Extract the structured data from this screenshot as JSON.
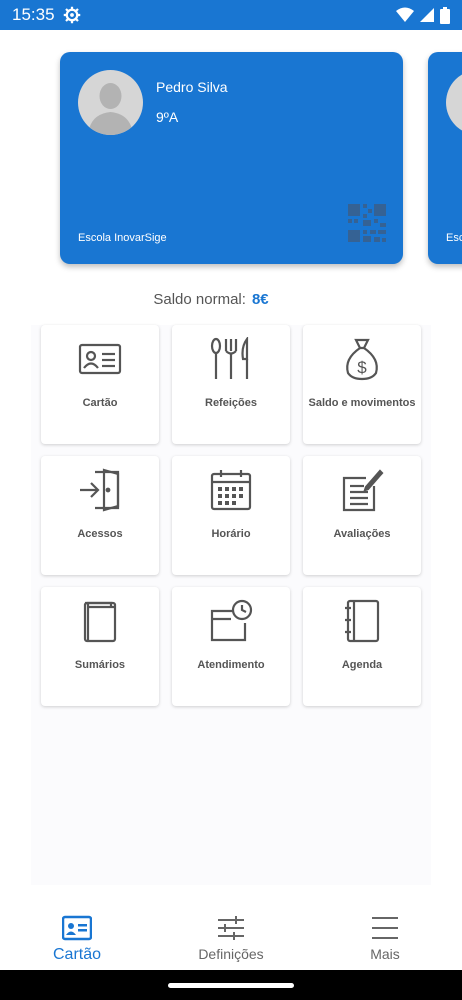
{
  "status_bar": {
    "time": "15:35"
  },
  "cards": [
    {
      "name": "Pedro Silva",
      "grade": "9ºA",
      "school": "Escola InovarSige"
    },
    {
      "school_partial": "Esco"
    }
  ],
  "balance": {
    "label": "Saldo normal:",
    "value": "8€"
  },
  "tiles": [
    {
      "label": "Cartão",
      "icon": "id-card-icon"
    },
    {
      "label": "Refeições",
      "icon": "cutlery-icon"
    },
    {
      "label": "Saldo e movimentos",
      "icon": "money-bag-icon"
    },
    {
      "label": "Acessos",
      "icon": "door-enter-icon"
    },
    {
      "label": "Horário",
      "icon": "calendar-icon"
    },
    {
      "label": "Avaliações",
      "icon": "evaluation-icon"
    },
    {
      "label": "Sumários",
      "icon": "book-icon"
    },
    {
      "label": "Atendimento",
      "icon": "appointment-icon"
    },
    {
      "label": "Agenda",
      "icon": "agenda-icon"
    }
  ],
  "bottom_nav": [
    {
      "label": "Cartão",
      "active": true
    },
    {
      "label": "Definições"
    },
    {
      "label": "Mais"
    }
  ],
  "colors": {
    "primary": "#1976d2",
    "icon": "#555555"
  }
}
